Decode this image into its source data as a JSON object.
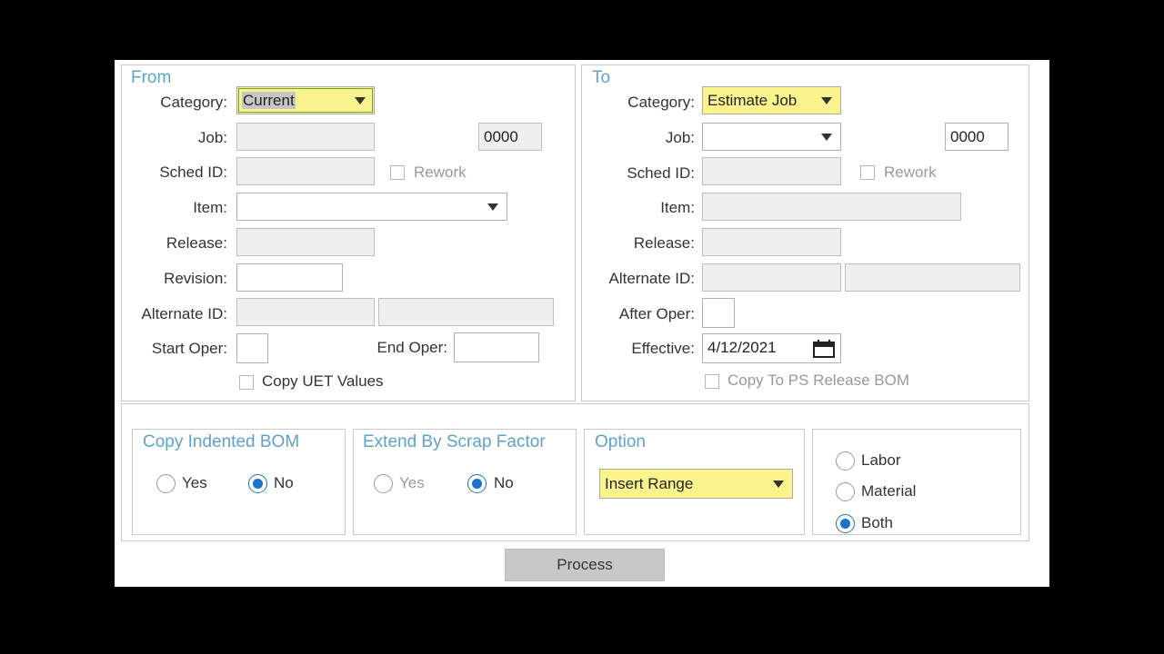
{
  "from": {
    "title": "From",
    "category_label": "Category:",
    "category_value": "Current",
    "job_label": "Job:",
    "job_value": "",
    "job_suffix": "0000",
    "sched_id_label": "Sched ID:",
    "rework_label": "Rework",
    "item_label": "Item:",
    "release_label": "Release:",
    "revision_label": "Revision:",
    "alternate_id_label": "Alternate ID:",
    "start_oper_label": "Start Oper:",
    "end_oper_label": "End Oper:",
    "copy_uet_label": "Copy UET Values"
  },
  "to": {
    "title": "To",
    "category_label": "Category:",
    "category_value": "Estimate Job",
    "job_label": "Job:",
    "job_suffix": "0000",
    "sched_id_label": "Sched ID:",
    "rework_label": "Rework",
    "item_label": "Item:",
    "release_label": "Release:",
    "alternate_id_label": "Alternate ID:",
    "after_oper_label": "After Oper:",
    "effective_label": "Effective:",
    "effective_value": "4/12/2021",
    "copy_ps_label": "Copy To PS Release BOM"
  },
  "copy_indented": {
    "title": "Copy Indented BOM",
    "yes": "Yes",
    "no": "No",
    "selected": "No"
  },
  "extend_scrap": {
    "title": "Extend By Scrap Factor",
    "yes": "Yes",
    "no": "No",
    "selected": "No"
  },
  "option": {
    "title": "Option",
    "value": "Insert Range"
  },
  "cost_type": {
    "labor": "Labor",
    "material": "Material",
    "both": "Both",
    "selected": "Both"
  },
  "process_label": "Process",
  "icons": {
    "dropdown": "chevron-down-icon",
    "calendar": "calendar-icon"
  }
}
